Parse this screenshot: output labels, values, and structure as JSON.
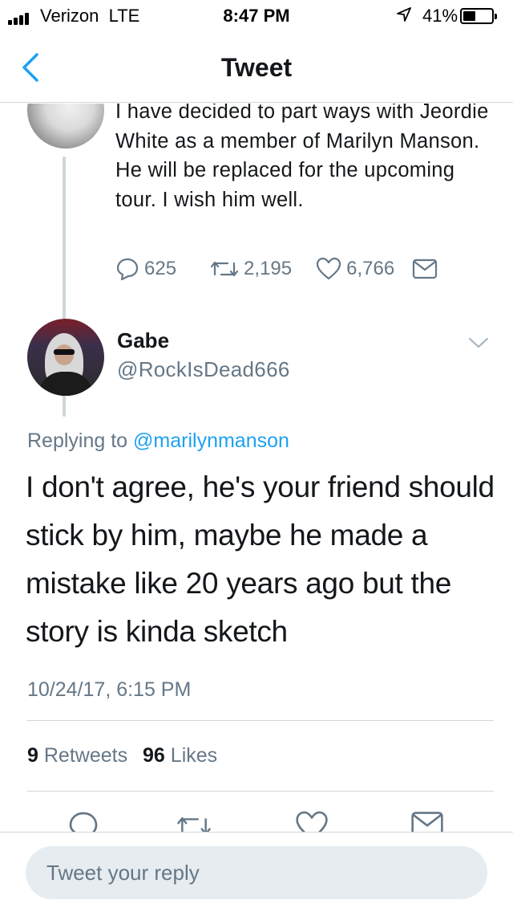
{
  "status_bar": {
    "carrier": "Verizon",
    "network": "LTE",
    "time": "8:47 PM",
    "battery": "41%",
    "battery_level": 0.41
  },
  "nav": {
    "title": "Tweet",
    "back_icon": "chevron-left-icon"
  },
  "parent_tweet": {
    "text": "I have decided to part ways with Jeordie White as a member of Marilyn Manson. He will be replaced for the upcoming tour. I wish him well.",
    "replies": "625",
    "retweets": "2,195",
    "likes": "6,766"
  },
  "reply_tweet": {
    "name": "Gabe",
    "handle": "@RockIsDead666",
    "replying_prefix": "Replying to",
    "replying_to": "@marilynmanson",
    "text": "I don't agree, he's your friend should stick by him, maybe he made a mistake like 20 years ago but the story is kinda sketch",
    "timestamp": "10/24/17, 6:15 PM",
    "retweet_count": "9",
    "retweet_label": "Retweets",
    "like_count": "96",
    "like_label": "Likes"
  },
  "compose": {
    "placeholder": "Tweet your reply"
  },
  "colors": {
    "accent": "#1da1f2",
    "secondary_text": "#657786",
    "primary_text": "#14171a",
    "divider": "#d0d7dc"
  }
}
